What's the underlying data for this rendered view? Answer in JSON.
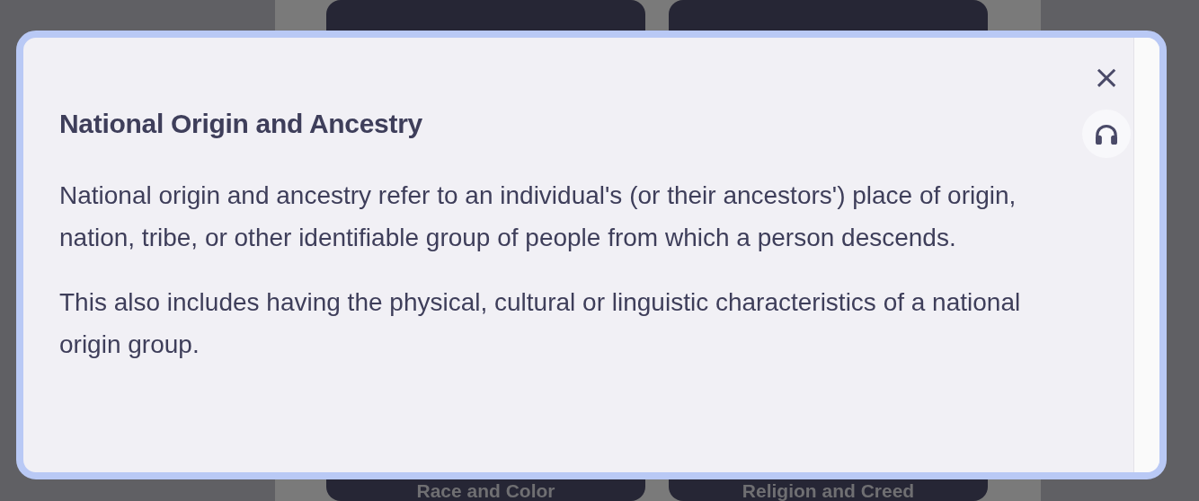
{
  "background_cards": [
    {
      "label": "Race and Color"
    },
    {
      "label": "Religion and Creed"
    }
  ],
  "dialog": {
    "title": "National Origin and Ancestry",
    "paragraphs": [
      "National origin and ancestry refer to an individual's (or their ancestors') place of origin, nation, tribe, or other identifiable group of people from which a person descends.",
      "This also includes having the physical, cultural or linguistic characteristics of a national origin group."
    ],
    "close_label": "×"
  }
}
